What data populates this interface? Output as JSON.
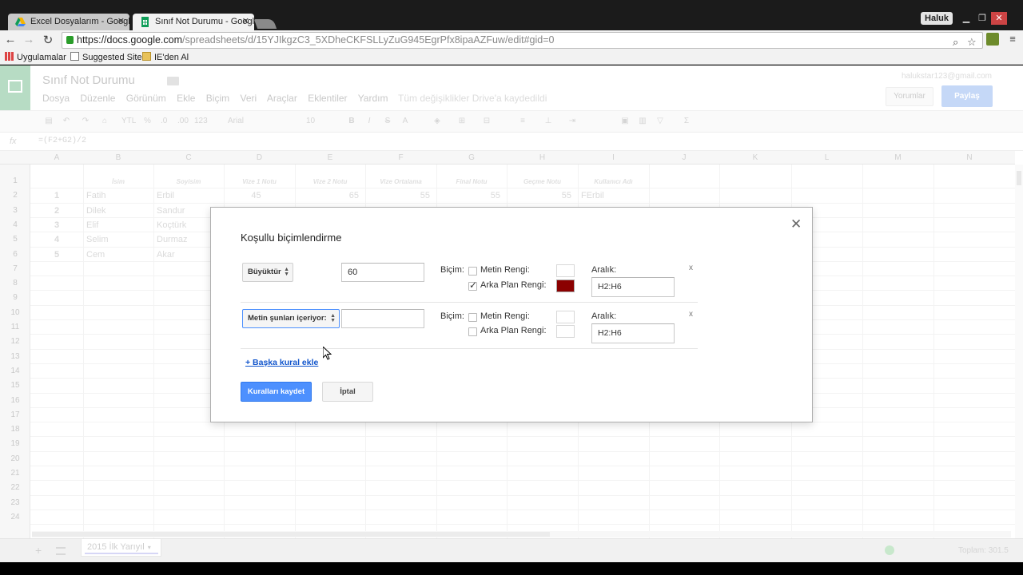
{
  "browser": {
    "tabs": [
      {
        "title": "Excel Dosyalarım - Google",
        "active": false
      },
      {
        "title": "Sınıf Not Durumu - Googl",
        "active": true
      }
    ],
    "profile_name": "Haluk",
    "url_host": "https://docs.google.com",
    "url_path": "/spreadsheets/d/15YJIkgzC3_5XDheCKFSLLyZuG945EgrPfx8ipaAZFuw/edit#gid=0",
    "bookmarks": [
      "Uygulamalar",
      "Suggested Sites",
      "IE'den Al"
    ]
  },
  "sheets": {
    "doc_title": "Sınıf Not Durumu",
    "menu": [
      "Dosya",
      "Düzenle",
      "Görünüm",
      "Ekle",
      "Biçim",
      "Veri",
      "Araçlar",
      "Eklentiler",
      "Yardım"
    ],
    "saved_message": "Tüm değişiklikler Drive'a kaydedildi",
    "user_email": "halukstar123@gmail.com",
    "comments_label": "Yorumlar",
    "share_label": "Paylaş",
    "format_bar": {
      "currency": "YTL",
      "percent": "%",
      "dec_less": ".0",
      "dec_more": ".00",
      "more_formats": "123",
      "font": "Arial",
      "size": "10"
    },
    "formula": "=(F2+G2)/2",
    "columns": [
      "A",
      "B",
      "C",
      "D",
      "E",
      "F",
      "G",
      "H",
      "I",
      "J",
      "K",
      "L",
      "M",
      "N"
    ],
    "header_row": [
      "",
      "İsim",
      "Soyisim",
      "Vize 1 Notu",
      "Vize 2 Notu",
      "Vize Ortalama",
      "Final Notu",
      "Geçme Notu",
      "Kullanıcı Adı"
    ],
    "data_rows": [
      {
        "a": "1",
        "b": "Fatih",
        "c": "Erbil",
        "d": "45",
        "e": "65",
        "f": "55",
        "g": "55",
        "h": "55",
        "i": "FErbil"
      },
      {
        "a": "2",
        "b": "Dilek",
        "c": "Sandur"
      },
      {
        "a": "3",
        "b": "Elif",
        "c": "Koçtürk"
      },
      {
        "a": "4",
        "b": "Selim",
        "c": "Durmaz"
      },
      {
        "a": "5",
        "b": "Cem",
        "c": "Akar"
      }
    ],
    "row_numbers": [
      "1",
      "2",
      "3",
      "4",
      "5",
      "6",
      "7",
      "8",
      "9",
      "10",
      "11",
      "12",
      "13",
      "14",
      "15",
      "16",
      "17",
      "18",
      "19",
      "20",
      "21",
      "22",
      "23",
      "24"
    ],
    "sheet_tab": "2015 İlk Yarıyıl",
    "status_sum": "Toplam: 301.5"
  },
  "dialog": {
    "title": "Koşullu biçimlendirme",
    "format_label": "Biçim:",
    "text_color_label": "Metin Rengi:",
    "bg_color_label": "Arka Plan Rengi:",
    "range_label": "Aralık:",
    "remove_label": "x",
    "rules": [
      {
        "condition": "Büyüktür",
        "value": "60",
        "text_color_checked": false,
        "bg_color_checked": true,
        "bg_color": "#8b0000",
        "range": "H2:H6"
      },
      {
        "condition": "Metin şunları içeriyor:",
        "value": "",
        "text_color_checked": false,
        "bg_color_checked": false,
        "range": "H2:H6"
      }
    ],
    "add_rule_label": "+ Başka kural ekle",
    "save_label": "Kuralları kaydet",
    "cancel_label": "İptal"
  },
  "colors": {
    "accent_blue": "#4d90fe",
    "link_blue": "#1155cc",
    "bg_swatch": "#8b0000"
  }
}
